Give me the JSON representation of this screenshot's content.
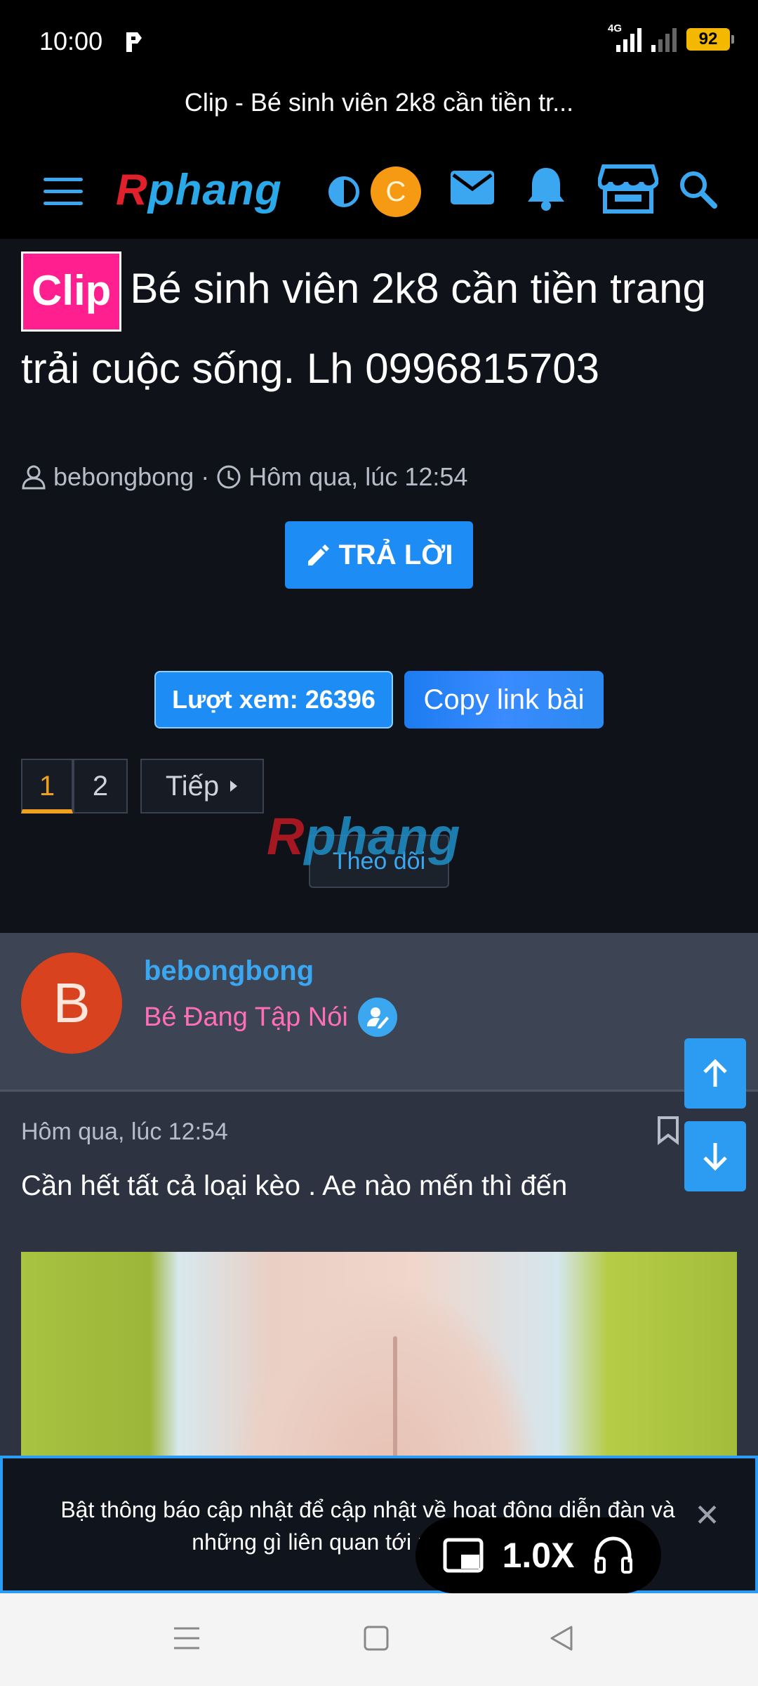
{
  "status_bar": {
    "time": "10:00",
    "network": "4G",
    "battery": "92"
  },
  "browser": {
    "title": "Clip - Bé sinh viên 2k8 cần tiền tr..."
  },
  "header": {
    "logo_r": "R",
    "logo_rest": "phang",
    "avatar_letter": "C",
    "icons": [
      "menu-icon",
      "theme-toggle-icon",
      "mail-icon",
      "bell-icon",
      "store-icon",
      "search-icon"
    ]
  },
  "thread": {
    "prefix": "Clip",
    "title": "Bé sinh viên 2k8 cần tiền trang trải cuộc sống. Lh 0996815703",
    "author": "bebongbong",
    "separator": "·",
    "date": "Hôm qua, lúc 12:54",
    "reply_label": "TRẢ LỜI",
    "views_label": "Lượt xem: 26396",
    "copy_label": "Copy link bài",
    "pages": [
      "1",
      "2"
    ],
    "next_label": "Tiếp",
    "follow_label": "Theo dõi",
    "watermark_r": "R",
    "watermark_rest": "phang"
  },
  "user": {
    "avatar_letter": "B",
    "name": "bebongbong",
    "title": "Bé Đang Tập Nói"
  },
  "post": {
    "date": "Hôm qua, lúc 12:54",
    "text": "Cần hết tất cả loại kèo . Ae nào mến thì đến"
  },
  "notification": {
    "text": "Bật thông báo cập nhật để cập nhật về hoạt động diễn đàn và những gì liên quan tới nick của bạn",
    "close": "✕"
  },
  "media": {
    "speed": "1.0X"
  },
  "colors": {
    "accent": "#1e8cf5",
    "link": "#3aa7f0",
    "pink": "#ff1f8e",
    "orange": "#f59a12"
  }
}
